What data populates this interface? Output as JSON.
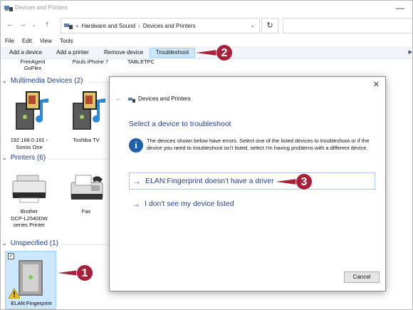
{
  "window": {
    "title": "Devices and Printers",
    "minimize_glyph": "—"
  },
  "address_bar": {
    "overflow_chevron": "«",
    "breadcrumbs": [
      "Hardware and Sound",
      "Devices and Printers"
    ],
    "separator": "›",
    "dropdown_glyph": "⌄",
    "refresh_glyph": "↻"
  },
  "nav": {
    "back_glyph": "←",
    "forward_glyph": "→",
    "recent_glyph": "⌄",
    "up_glyph": "↑"
  },
  "menubar": [
    "File",
    "Edit",
    "View",
    "Tools"
  ],
  "commandbar": {
    "items": [
      "Add a device",
      "Add a printer",
      "Remove device",
      "Troubleshoot"
    ],
    "active": "Troubleshoot"
  },
  "partial_row": {
    "items": [
      "FreeAgent\nGoFlex",
      "Pauls iPhone 7",
      "TABLETPC"
    ]
  },
  "sections": {
    "multimedia": {
      "title": "Multimedia Devices (2)",
      "devices": [
        "192.168.0.161 -\nSonos One",
        "Toshiba TV"
      ]
    },
    "printers": {
      "title": "Printers (6)",
      "devices": [
        "Brother\nDCP-L2540DW\nseries Printer",
        "Fax"
      ]
    },
    "unspecified": {
      "title": "Unspecified (1)",
      "devices": [
        "ELAN:Fingerprint"
      ]
    }
  },
  "dialog": {
    "app_title": "Devices and Printers",
    "close_glyph": "✕",
    "back_glyph": "←",
    "heading": "Select a device to troubleshoot",
    "info_glyph": "i",
    "info_text": "The devices shown below have errors. Select one of the listed devices to troubleshoot or if the device you need to troubleshoot isn't listed, select I'm having problems with a different device.",
    "options": [
      {
        "label": "ELAN:Fingerprint doesn't have a driver"
      },
      {
        "label": "I don't see my device listed"
      }
    ],
    "arrow_glyph": "→",
    "cancel_label": "Cancel"
  },
  "callouts": [
    "1",
    "2",
    "3"
  ],
  "colors": {
    "accent": "#1e3f8c",
    "callout": "#a8203a",
    "selection": "#cce8ff",
    "info": "#1d5fa8"
  }
}
